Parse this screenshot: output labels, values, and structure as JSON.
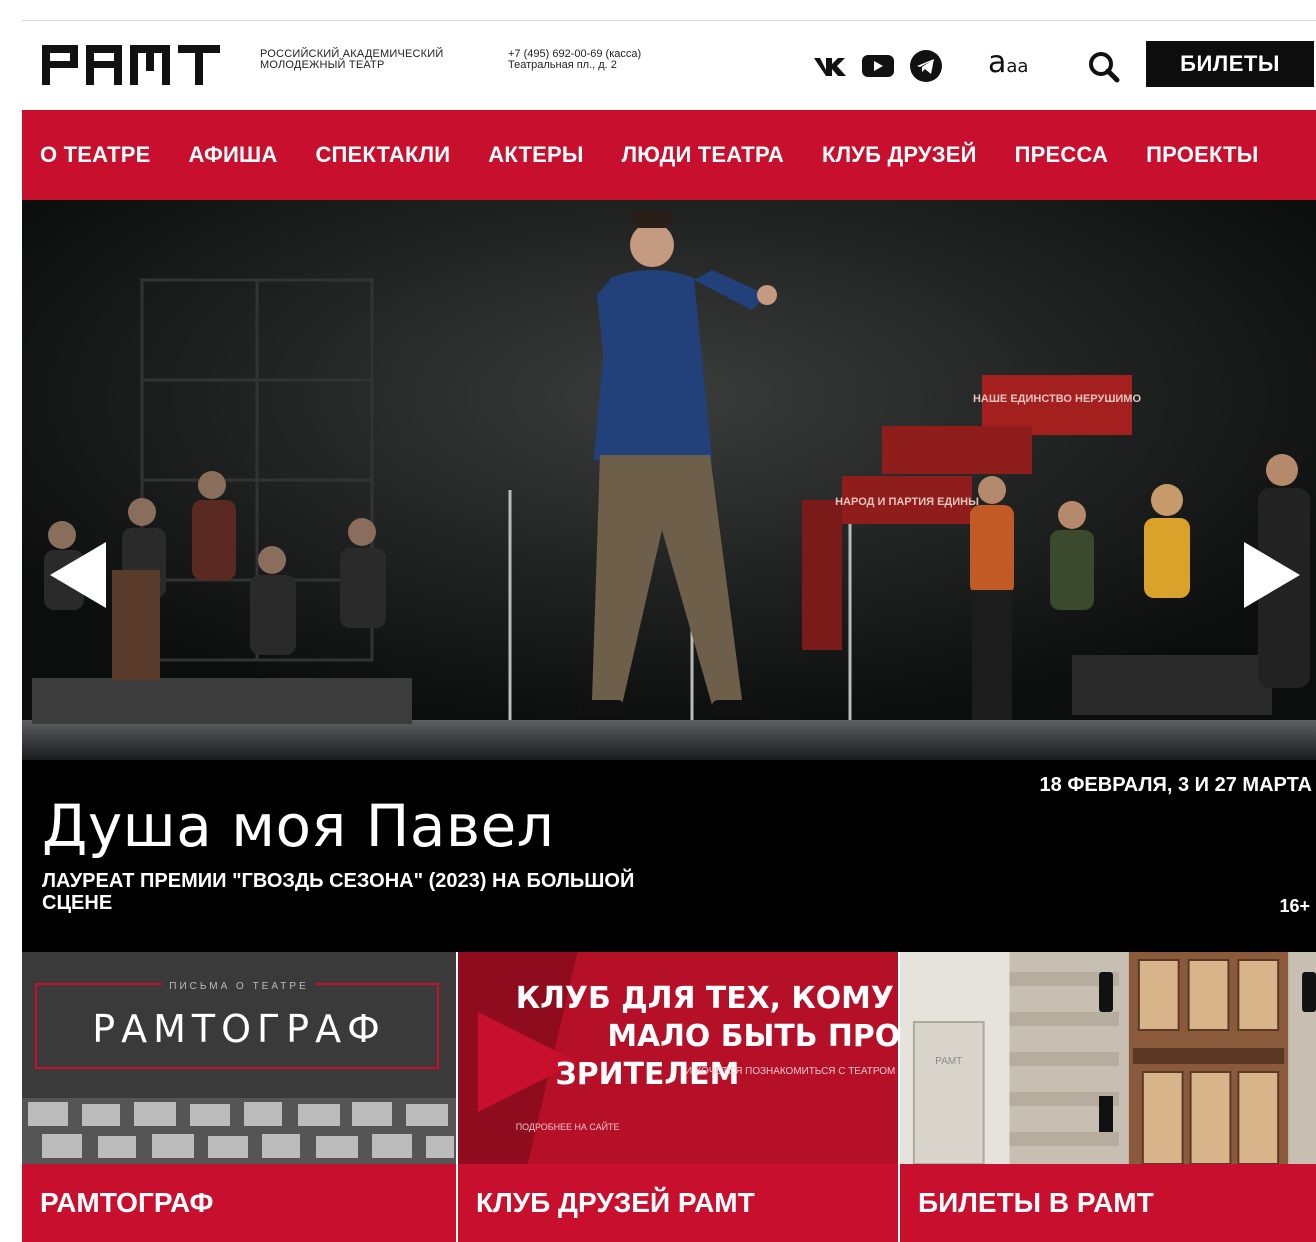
{
  "header": {
    "logo_text": "РАМТ",
    "org_name_line1": "Российский академический",
    "org_name_line2": "молодежный театр",
    "phone": "+7 (495) 692-00-69 (касса)",
    "address": "Театральная пл., д. 2",
    "socials": [
      {
        "name": "vk-icon",
        "label": "ВК"
      },
      {
        "name": "youtube-icon",
        "label": "YouTube"
      },
      {
        "name": "telegram-icon",
        "label": "Telegram"
      }
    ],
    "font_size_big": "a",
    "font_size_small": "aa",
    "tickets_label": "БИЛЕТЫ"
  },
  "nav": {
    "items": [
      {
        "label": "О ТЕАТРЕ"
      },
      {
        "label": "АФИША"
      },
      {
        "label": "СПЕКТАКЛИ"
      },
      {
        "label": "АКТЕРЫ"
      },
      {
        "label": "ЛЮДИ ТЕАТРА"
      },
      {
        "label": "КЛУБ ДРУЗЕЙ"
      },
      {
        "label": "ПРЕССА"
      },
      {
        "label": "ПРОЕКТЫ"
      }
    ]
  },
  "hero": {
    "title": "Душа моя Павел",
    "subtitle": "Лауреат премии \"Гвоздь сезона\" (2023) на большой сцене",
    "dates": "18 ФЕВРАЛЯ, 3 И 27 МАРТА",
    "age": "16+",
    "prop_sign_1": "НАШЕ ЕДИНСТВО НЕРУШИМО",
    "prop_sign_2": "НАРОД И ПАРТИЯ ЕДИНЫ"
  },
  "cards": [
    {
      "label": "РАМТОГРАФ",
      "img_caption": "ПИСЬМА О ТЕАТРЕ",
      "img_title": "РАМТОГРАФ"
    },
    {
      "label": "КЛУБ ДРУЗЕЙ РАМТ",
      "img_line1": "КЛУБ ДЛЯ ТЕХ, КОМУ",
      "img_line2": "МАЛО БЫТЬ ПРОСТО",
      "img_line3": "ЗРИТЕЛЕМ",
      "img_small": "И ХОЧЕТСЯ ПОЗНАКОМИТЬСЯ С ТЕАТРОМ ПОБЛИЖЕ",
      "img_footer": "ПОДРОБНЕЕ НА САЙТЕ"
    },
    {
      "label": "БИЛЕТЫ В РАМТ",
      "img_sign": "РАМТ"
    }
  ],
  "colors": {
    "brand_red": "#c8102e",
    "black": "#0d0d0d"
  }
}
